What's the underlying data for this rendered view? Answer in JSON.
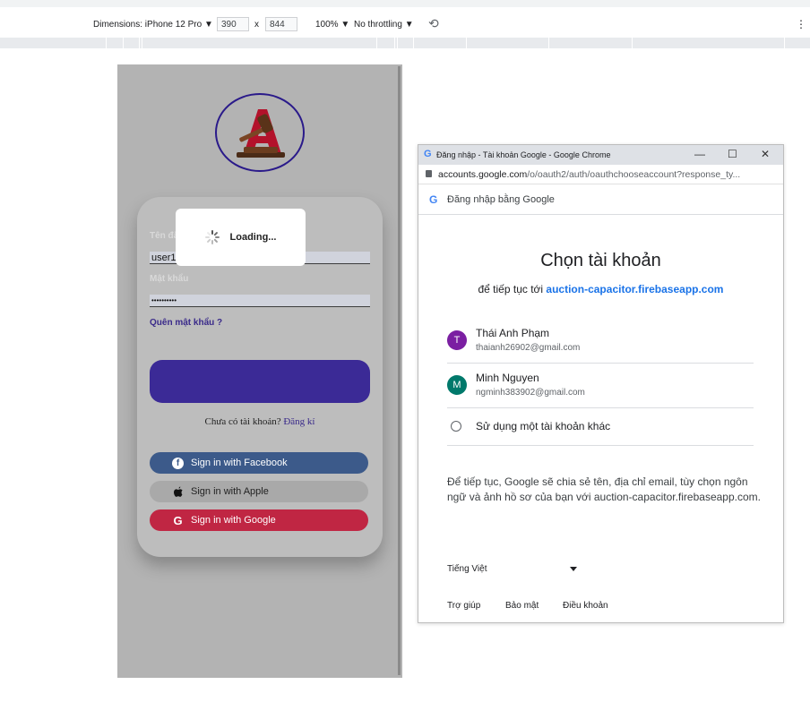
{
  "devtools": {
    "device_label": "Dimensions: iPhone 12 Pro ▼",
    "width": "390",
    "times": "x",
    "height": "844",
    "zoom": "100% ▼",
    "throttle": "No throttling ▼",
    "rotate_icon": "rotate-icon",
    "more": "⋮"
  },
  "app": {
    "logo_icon": "auction-gavel-logo",
    "username_label": "Tên đăng nhập / Email",
    "username_value": "user12345",
    "password_label": "Mật khẩu",
    "password_value": "••••••••••",
    "forgot": "Quên mật khẩu ?",
    "loading": "Loading...",
    "no_account": "Chưa có tài khoản?",
    "register": "Đăng kí",
    "facebook": "Sign in with Facebook",
    "apple": "Sign in with Apple",
    "google": "Sign in with Google"
  },
  "popup": {
    "window_title": "Đăng nhập - Tài khoản Google - Google Chrome",
    "minimize": "—",
    "maximize": "☐",
    "close": "✕",
    "url_host": "accounts.google.com",
    "url_rest": "/o/oauth2/auth/oauthchooseaccount?response_ty...",
    "header": "Đăng nhập bằng Google",
    "heading": "Chọn tài khoản",
    "subtitle_prefix": "để tiếp tục tới",
    "subtitle_app": "auction-capacitor.firebaseapp.com",
    "accounts": [
      {
        "initial": "T",
        "name": "Thái Anh Phạm",
        "email": "thaianh26902@gmail.com",
        "color": "#7b1fa2"
      },
      {
        "initial": "M",
        "name": "Minh Nguyen",
        "email": "ngminh383902@gmail.com",
        "color": "#00796b"
      }
    ],
    "other_account": "Sử dụng một tài khoản khác",
    "consent": "Để tiếp tục, Google sẽ chia sẻ tên, địa chỉ email, tùy chọn ngôn ngữ và ảnh hồ sơ của bạn với auction-capacitor.firebaseapp.com.",
    "language": "Tiếng Việt",
    "help": "Trợ giúp",
    "privacy": "Bảo mật",
    "terms": "Điều khoản"
  }
}
